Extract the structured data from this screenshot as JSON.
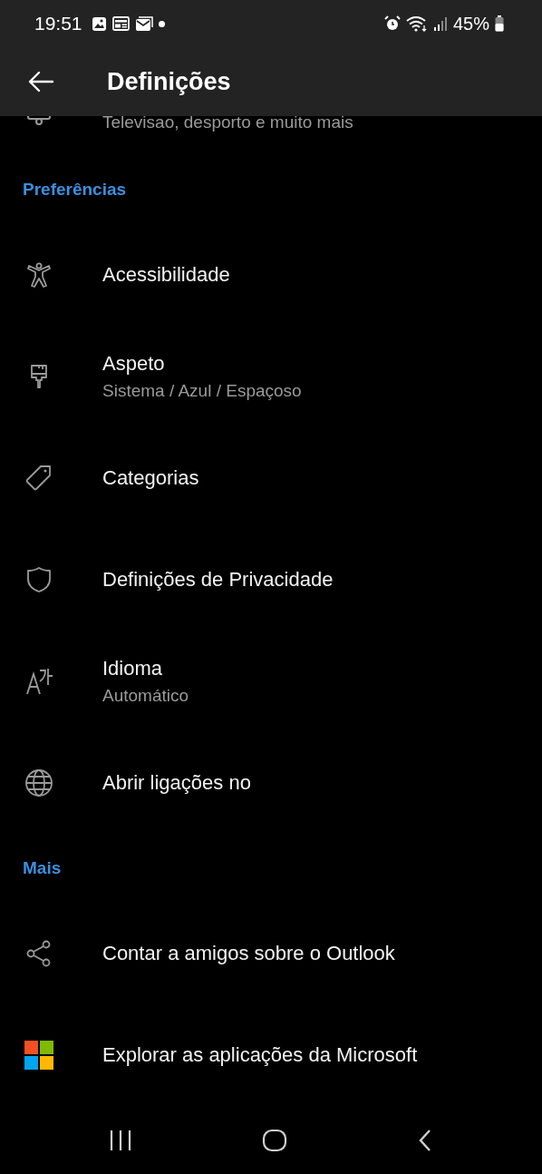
{
  "status_bar": {
    "time": "19:51",
    "battery": "45%"
  },
  "header": {
    "title": "Definições"
  },
  "partial_item": {
    "subtitle": "Televisao, desporto e muito mais"
  },
  "sections": [
    {
      "title": "Preferências",
      "items": [
        {
          "label": "Acessibilidade"
        },
        {
          "label": "Aspeto",
          "subtitle": "Sistema / Azul / Espaçoso"
        },
        {
          "label": "Categorias"
        },
        {
          "label": "Definições de Privacidade"
        },
        {
          "label": "Idioma",
          "subtitle": "Automático"
        },
        {
          "label": "Abrir ligações no"
        }
      ]
    },
    {
      "title": "Mais",
      "items": [
        {
          "label": "Contar a amigos sobre o Outlook"
        },
        {
          "label": "Explorar as aplicações da Microsoft"
        }
      ]
    }
  ]
}
